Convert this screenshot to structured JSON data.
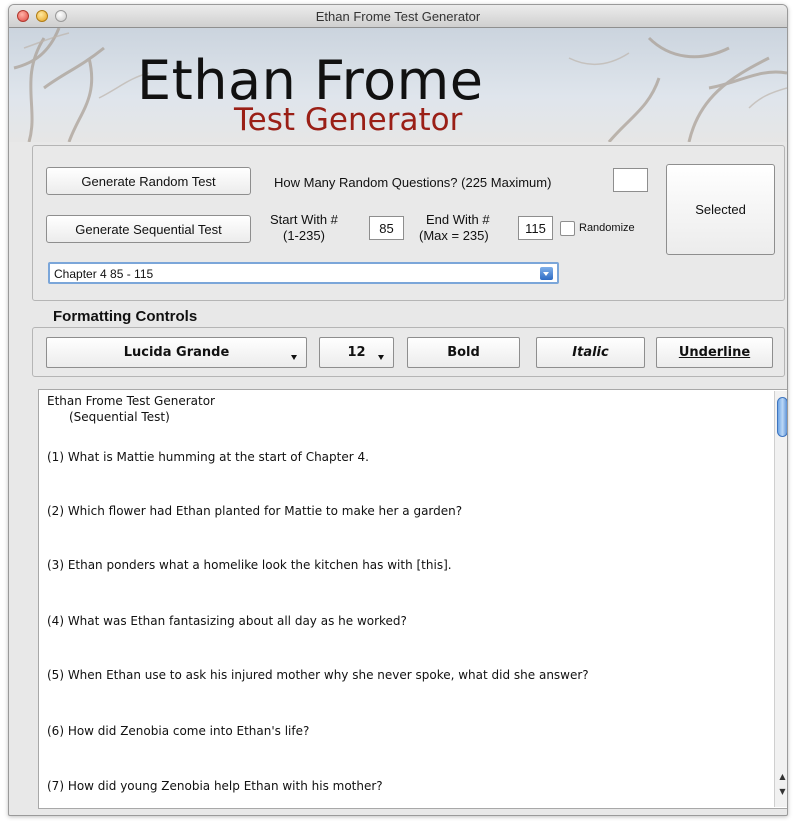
{
  "window": {
    "title": "Ethan Frome Test Generator"
  },
  "banner": {
    "title": "Ethan Frome",
    "subtitle": "Test Generator"
  },
  "controls": {
    "random_button": "Generate Random Test",
    "random_label": "How Many Random Questions? (225 Maximum)",
    "random_count": "",
    "sequential_button": "Generate Sequential Test",
    "start_label": "Start With #",
    "start_range": "(1-235)",
    "start_value": "85",
    "end_label": "End With #",
    "end_range": "(Max = 235)",
    "end_value": "115",
    "randomize_label": "Randomize",
    "selected_button": "Selected",
    "chapter_select": "Chapter 4   85 - 115"
  },
  "formatting": {
    "title": "Formatting Controls",
    "font": "Lucida Grande",
    "size": "12",
    "bold": "Bold",
    "italic": "Italic",
    "underline": "Underline"
  },
  "output": {
    "header": "Ethan Frome Test Generator",
    "subheader": "(Sequential Test)",
    "questions": [
      "(1)  What is Mattie humming at the start of Chapter 4.",
      "(2)  Which flower had Ethan planted for Mattie to make her a garden?",
      "(3)  Ethan ponders what a homelike look the kitchen has with [this].",
      "(4)  What was Ethan fantasizing about all day as he worked?",
      "(5)  When Ethan use to ask his injured mother why she never spoke, what did she answer?",
      "(6)  How did Zenobia come into Ethan's life?",
      "(7)  How did young Zenobia help Ethan with his mother?"
    ]
  },
  "colors": {
    "accent": "#3d74bf",
    "subtitle": "#9a1f16"
  }
}
